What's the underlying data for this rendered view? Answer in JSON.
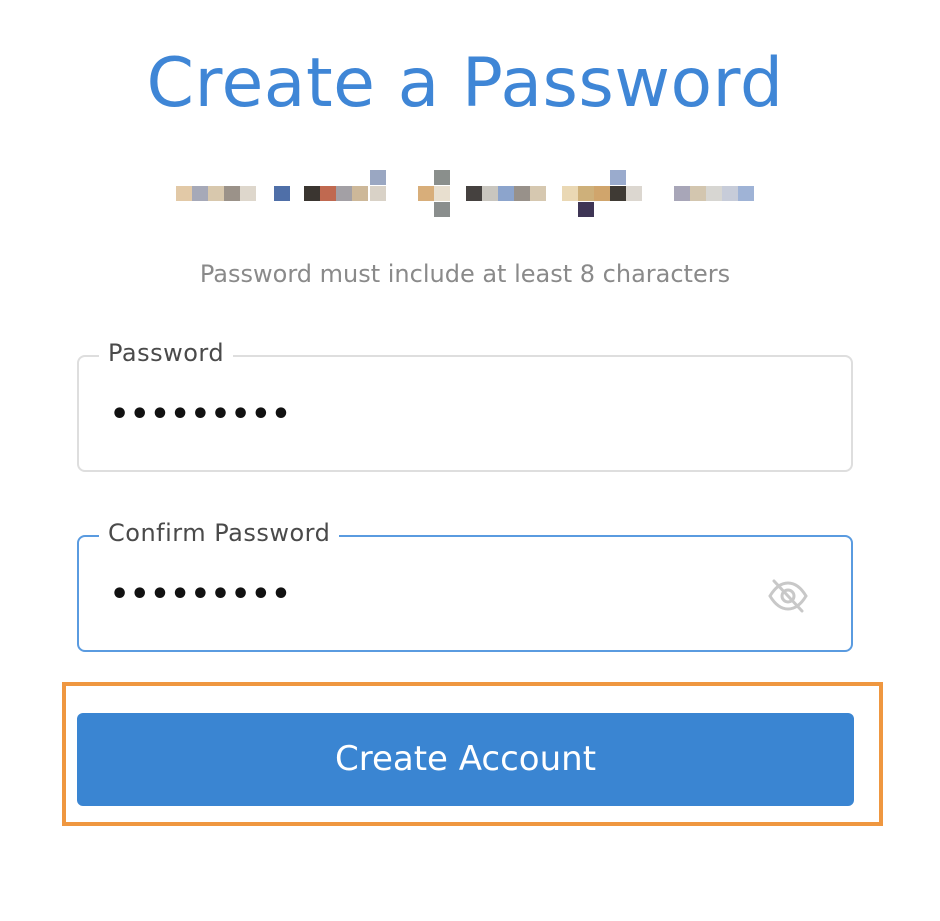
{
  "title": "Create a Password",
  "hint": "Password must include at least 8 characters",
  "password_field": {
    "label": "Password",
    "value": "•••••••••"
  },
  "confirm_field": {
    "label": "Confirm Password",
    "value": "•••••••••",
    "toggle_icon": "eye-off-icon"
  },
  "create_button": {
    "label": "Create Account"
  },
  "colors": {
    "accent": "#3a85d2",
    "title": "#3f86d6",
    "highlight": "#ef9740",
    "hint": "#8a8a8a"
  }
}
